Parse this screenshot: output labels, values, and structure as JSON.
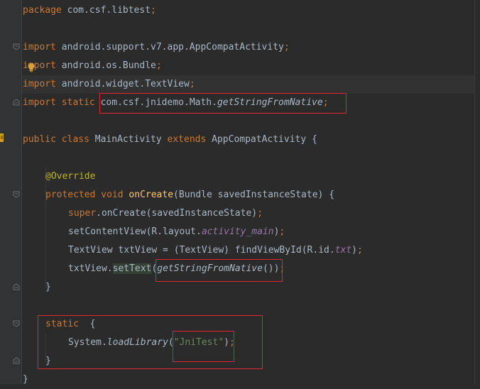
{
  "editor": {
    "lines": {
      "l1": {
        "package_kw": "package",
        "package_name": " com.csf.libtest",
        "semi": ";"
      },
      "l3": {
        "import_kw": "import",
        "text": " android.support.v7.app.AppCompatActivity",
        "semi": ";"
      },
      "l4": {
        "import_kw": "import",
        "text": " android.os.Bundle",
        "semi": ";"
      },
      "l5": {
        "import_kw": "import",
        "text": " android.widget.TextView",
        "semi": ";"
      },
      "l6": {
        "import_kw": "import",
        "static_kw": " static",
        "space": " ",
        "path": "com.csf.jnidemo.Math.",
        "method": "getStringFromNative",
        "semi": ";"
      },
      "l8": {
        "public_kw": "public",
        "class_kw": " class",
        "name": " MainActivity ",
        "extends_kw": "extends",
        "parent": " AppCompatActivity {"
      },
      "l10": {
        "annotation": "@Override"
      },
      "l11": {
        "protected_kw": "protected",
        "void_kw": " void",
        "space": " ",
        "method": "onCreate",
        "rest": "(Bundle savedInstanceState) {"
      },
      "l12": {
        "super_kw": "super",
        "rest": ".onCreate(savedInstanceState)",
        "semi": ";"
      },
      "l13": {
        "start": "setContentView(R.layout.",
        "field": "activity_main",
        "end": ")",
        "semi": ";"
      },
      "l14": {
        "start": "TextView txtView = (TextView) findViewById(R.id.",
        "field": "txt",
        "end": ")",
        "semi": ";"
      },
      "l15": {
        "start": "txtView.",
        "call": "setText",
        "paren": "(",
        "inner": "getStringFromNative",
        "end": "())",
        "semi": ";"
      },
      "l16": {
        "text": "}"
      },
      "l18": {
        "static_kw": "static",
        "rest": "  {"
      },
      "l19": {
        "start": "System.",
        "call": "loadLibrary",
        "paren": "(",
        "string": "\"JniTest\"",
        "end": ")",
        "semi": ";"
      },
      "l20": {
        "text": "}"
      },
      "l21": {
        "text": "}"
      }
    }
  },
  "colors": {
    "background": "#2b2b2b",
    "keyword": "#cc7832",
    "annotation": "#bbb529",
    "method_decl": "#ffc66d",
    "field": "#9876aa",
    "string": "#6a8759",
    "default_text": "#a9b7c6",
    "highlight_box": "#e0262c"
  },
  "icons": [
    "fold-icon",
    "lightbulb-icon",
    "override-marker-icon"
  ]
}
